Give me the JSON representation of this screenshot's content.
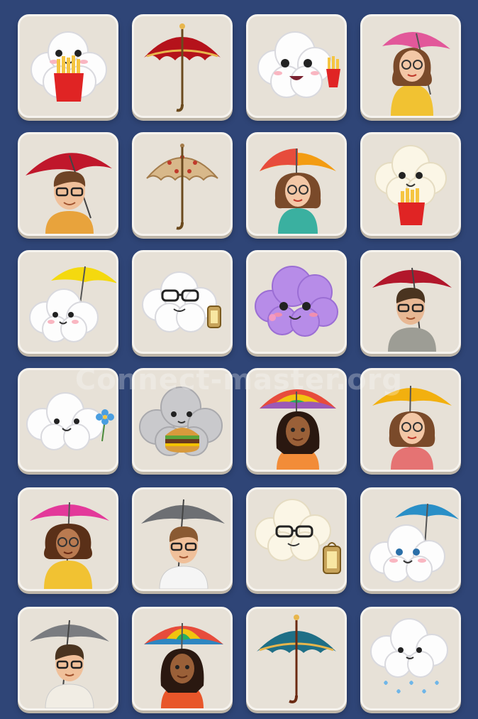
{
  "watermark": "Connect-master.org",
  "tiles": [
    {
      "icon": "cloud-fries-icon"
    },
    {
      "icon": "red-parasol-icon"
    },
    {
      "icon": "cloud-fries-icon"
    },
    {
      "icon": "woman-yellow-raincoat-pink-umbrella-icon"
    },
    {
      "icon": "man-glasses-red-umbrella-icon"
    },
    {
      "icon": "lace-parasol-icon"
    },
    {
      "icon": "woman-orange-umbrella-icon"
    },
    {
      "icon": "cloud-fries-icon"
    },
    {
      "icon": "cloud-yellow-umbrella-icon"
    },
    {
      "icon": "cloud-glasses-lantern-icon"
    },
    {
      "icon": "purple-cloud-icon"
    },
    {
      "icon": "man-glasses-red-umbrella-icon"
    },
    {
      "icon": "cloud-flower-icon"
    },
    {
      "icon": "grey-cloud-burger-icon"
    },
    {
      "icon": "woman-braids-rainbow-umbrella-icon"
    },
    {
      "icon": "woman-glasses-yellow-umbrella-icon"
    },
    {
      "icon": "woman-yellow-raincoat-pink-umbrella-icon"
    },
    {
      "icon": "man-glasses-grey-umbrella-icon"
    },
    {
      "icon": "cloud-glasses-lantern-icon"
    },
    {
      "icon": "cloud-blue-umbrella-icon"
    },
    {
      "icon": "man-glasses-grey-umbrella-icon"
    },
    {
      "icon": "woman-braids-rainbow-umbrella-icon"
    },
    {
      "icon": "teal-parasol-icon"
    },
    {
      "icon": "rain-cloud-icon"
    }
  ]
}
